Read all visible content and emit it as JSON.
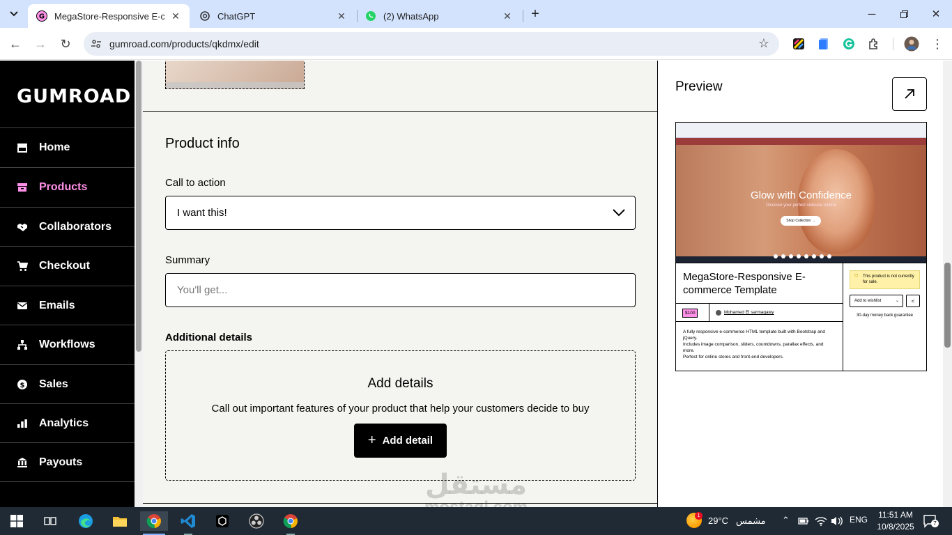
{
  "browser": {
    "tabs": [
      {
        "title": "MegaStore-Responsive E-comm",
        "active": true
      },
      {
        "title": "ChatGPT",
        "active": false
      },
      {
        "title": "(2) WhatsApp",
        "active": false
      }
    ],
    "url": "gumroad.com/products/qkdmx/edit"
  },
  "sidebar": {
    "logo": "GUMROAD",
    "items": [
      {
        "label": "Home",
        "icon": "store-icon",
        "active": false
      },
      {
        "label": "Products",
        "icon": "archive-box-icon",
        "active": true
      },
      {
        "label": "Collaborators",
        "icon": "handshake-icon",
        "active": false
      },
      {
        "label": "Checkout",
        "icon": "cart-icon",
        "active": false
      },
      {
        "label": "Emails",
        "icon": "envelope-icon",
        "active": false
      },
      {
        "label": "Workflows",
        "icon": "workflow-icon",
        "active": false
      },
      {
        "label": "Sales",
        "icon": "dollar-circle-icon",
        "active": false
      },
      {
        "label": "Analytics",
        "icon": "bar-chart-icon",
        "active": false
      },
      {
        "label": "Payouts",
        "icon": "bank-icon",
        "active": false
      }
    ]
  },
  "editor": {
    "section_title": "Product info",
    "cta_label": "Call to action",
    "cta_value": "I want this!",
    "summary_label": "Summary",
    "summary_placeholder": "You'll get...",
    "additional_label": "Additional details",
    "details_title": "Add details",
    "details_sub": "Call out important features of your product that help your customers decide to buy",
    "add_button": "Add detail"
  },
  "preview": {
    "title": "Preview",
    "hero_title": "Glow with Confidence",
    "hero_sub": "Discover your perfect skincare routine",
    "hero_button": "Shop Collection  →",
    "product_name": "MegaStore-Responsive E-commerce Template",
    "price": "$100",
    "author": "Mohamed El sarmagawy",
    "description_lines": [
      "A fully responsive e-commerce HTML template built with Bootstrap and jQuery.",
      "Includes image comparison, sliders, countdowns, parallax effects, and more.",
      "Perfect for online stores and front-end developers."
    ],
    "notice": "This product is not currently for sale.",
    "wishlist": "Add to wishlist",
    "guarantee": "30-day money back guarantee"
  },
  "watermark": {
    "arabic": "مستقل",
    "latin": "mostaql.com"
  },
  "taskbar": {
    "weather_temp": "29°C",
    "weather_text": "مشمس",
    "weather_badge": "1",
    "language": "ENG",
    "time": "11:51 AM",
    "date": "10/8/2025",
    "notification_count": "7"
  },
  "colors": {
    "accent_pink": "#ff90e8",
    "sidebar_bg": "#000000",
    "editor_bg": "#f4f4f0",
    "tabstrip": "#d3e3fd"
  }
}
